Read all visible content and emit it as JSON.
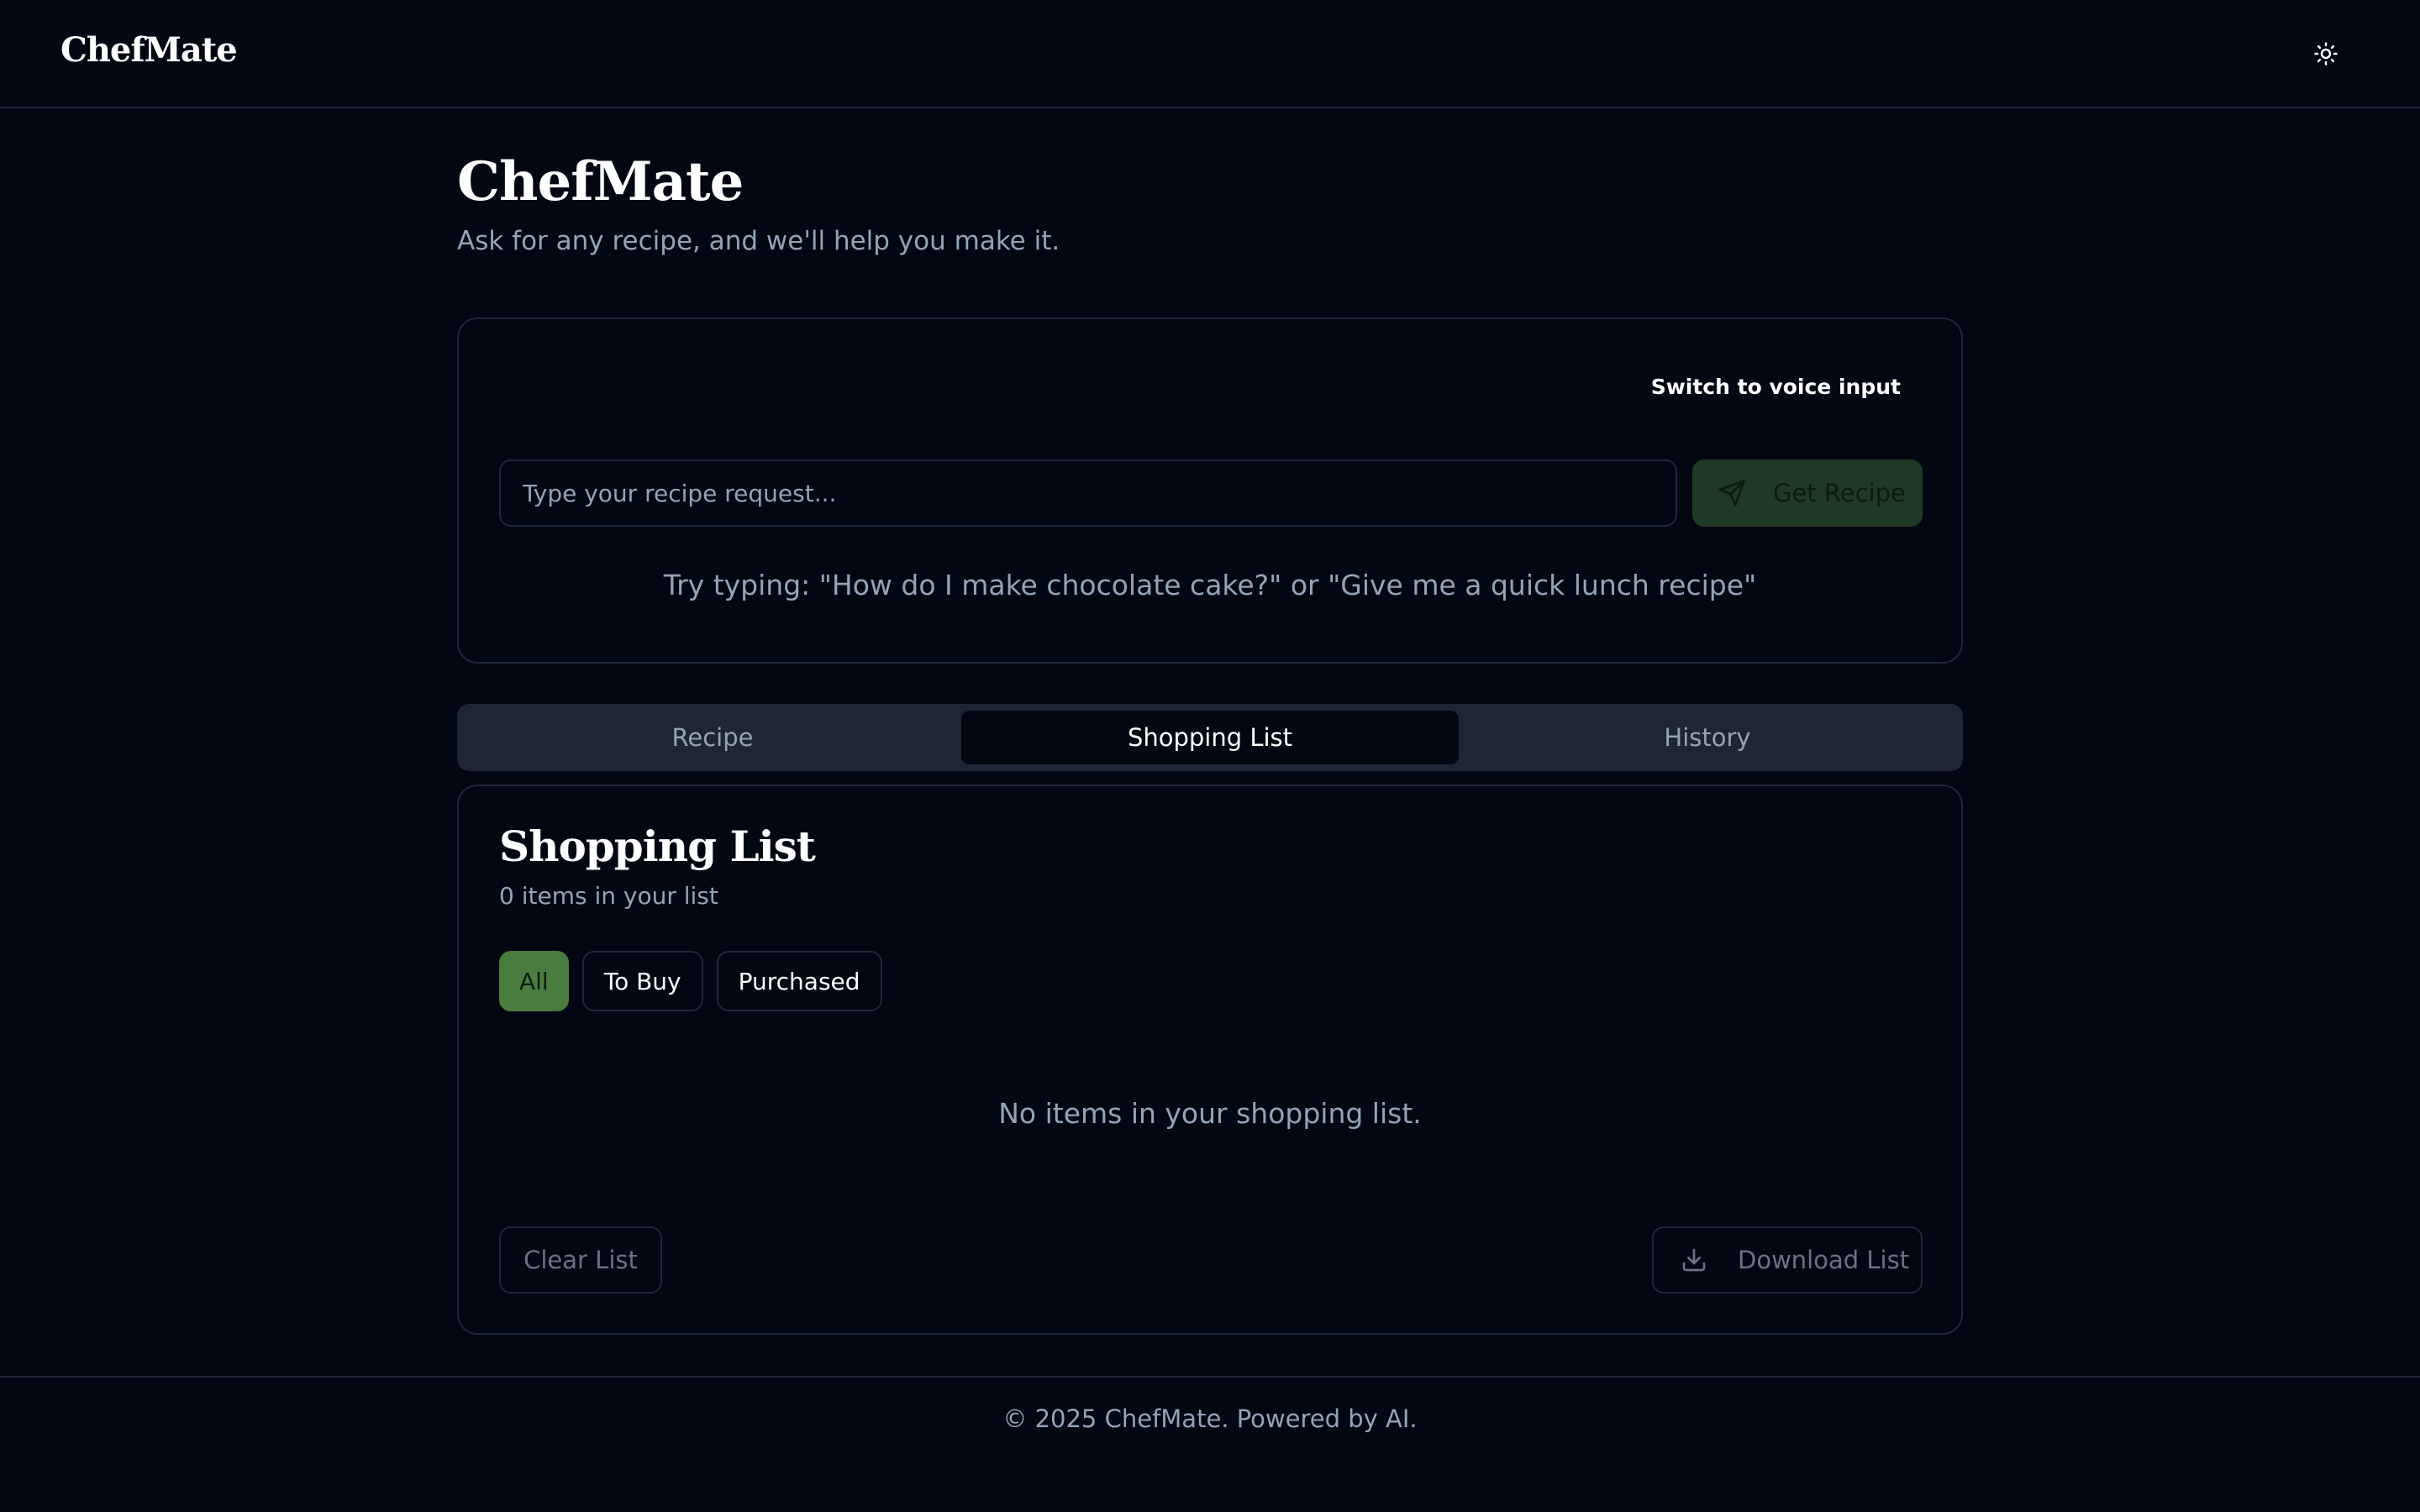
{
  "header": {
    "brand": "ChefMate",
    "theme_toggle_icon": "sun-icon"
  },
  "main": {
    "title": "ChefMate",
    "subtitle": "Ask for any recipe, and we'll help you make it."
  },
  "request": {
    "voice_toggle_label": "Switch to voice input",
    "input_placeholder": "Type your recipe request...",
    "input_value": "",
    "submit_label": "Get Recipe",
    "submit_icon": "send-icon",
    "hint": "Try typing: \"How do I make chocolate cake?\" or \"Give me a quick lunch recipe\""
  },
  "tabs": [
    {
      "label": "Recipe",
      "active": false
    },
    {
      "label": "Shopping List",
      "active": true
    },
    {
      "label": "History",
      "active": false
    }
  ],
  "shopping": {
    "title": "Shopping List",
    "count_text": "0 items in your list",
    "filters": [
      {
        "label": "All",
        "active": true
      },
      {
        "label": "To Buy",
        "active": false
      },
      {
        "label": "Purchased",
        "active": false
      }
    ],
    "empty_message": "No items in your shopping list.",
    "clear_label": "Clear List",
    "download_label": "Download List",
    "download_icon": "download-icon"
  },
  "footer": {
    "text": "© 2025 ChefMate. Powered by AI."
  },
  "colors": {
    "background": "#030712",
    "border": "#1f2937",
    "accent": "#4a7c3f",
    "muted_text": "#94a3b8"
  }
}
